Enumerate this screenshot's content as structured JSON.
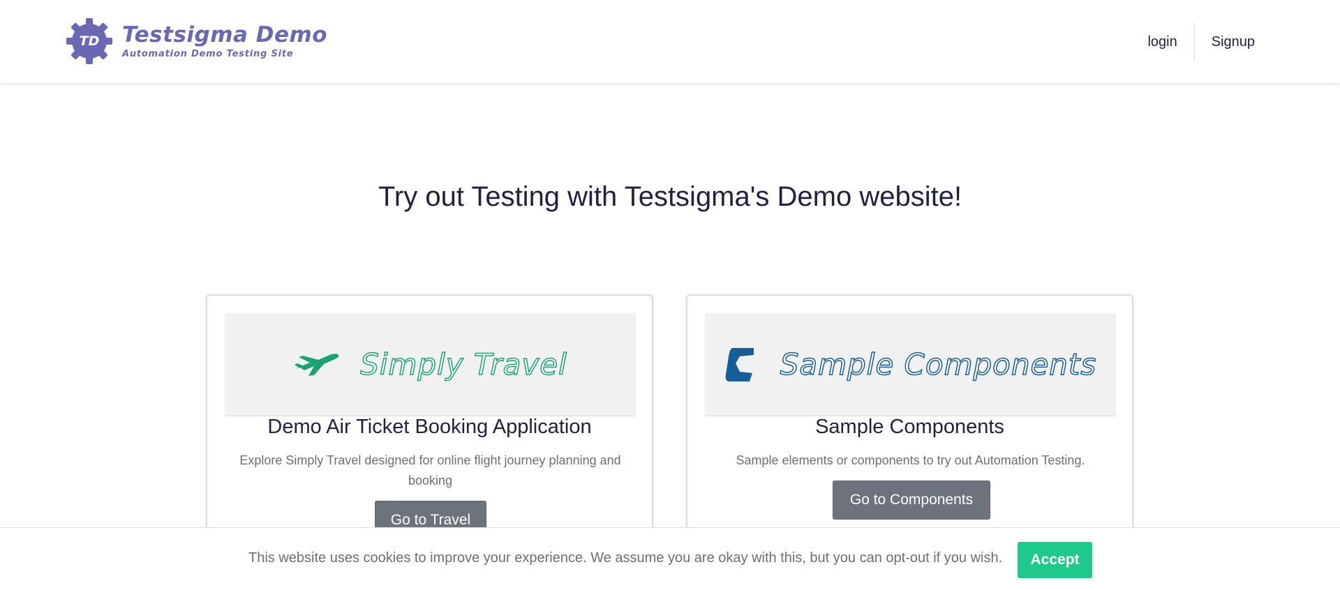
{
  "header": {
    "logo_badge": "TD",
    "logo_title": "Testsigma Demo",
    "logo_subtitle": "Automation Demo Testing Site",
    "nav": {
      "login": "login",
      "signup": "Signup"
    }
  },
  "hero": {
    "title": "Try out Testing with Testsigma's Demo website!"
  },
  "cards": [
    {
      "banner_text": "Simply Travel",
      "banner_icon": "airplane-icon",
      "heading": "Demo Air Ticket Booking Application",
      "description": "Explore Simply Travel designed for online flight journey planning and booking",
      "button": "Go to Travel"
    },
    {
      "banner_text": "Sample Components",
      "banner_icon": "components-c-icon",
      "heading": "Sample Components",
      "description": "Sample elements or components to try out Automation Testing.",
      "button": "Go to Components"
    }
  ],
  "cookie": {
    "text": "This website uses cookies to improve your experience. We assume you are okay with this, but you can opt-out if you wish.",
    "accept": "Accept"
  },
  "colors": {
    "brand": "#6b68b3",
    "travel_green": "#1aa374",
    "components_blue": "#165e97",
    "button_gray": "#6c737c",
    "accept_green": "#1fc98c"
  }
}
